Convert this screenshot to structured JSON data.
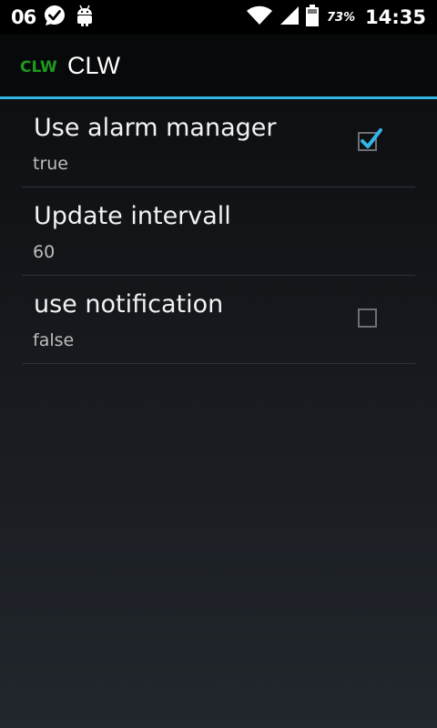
{
  "status_bar": {
    "left_number": "06",
    "notification_icons": [
      "check-bubble-icon",
      "android-icon"
    ],
    "right_icons": [
      "wifi-icon",
      "signal-icon",
      "battery-icon"
    ],
    "battery_percent": "73%",
    "time": "14:35"
  },
  "action_bar": {
    "app_icon_text": "CLW",
    "title": "CLW"
  },
  "accent_colors": {
    "divider": "#33b5e5",
    "app_icon": "#1e9a1e",
    "check": "#33b5e5"
  },
  "preferences": [
    {
      "title": "Use alarm manager",
      "summary": "true",
      "checked": true
    },
    {
      "title": "Update intervall",
      "summary": "60"
    },
    {
      "title": "use notification",
      "summary": "false",
      "checked": false
    }
  ]
}
